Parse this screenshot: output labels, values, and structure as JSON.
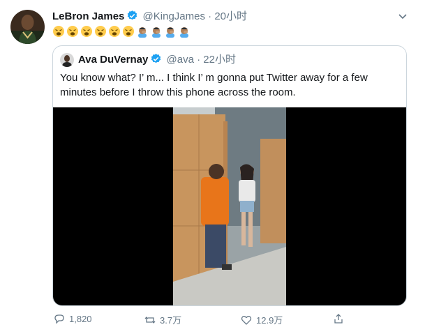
{
  "tweet": {
    "author_name": "LeBron James",
    "handle": "@KingJames",
    "separator": "·",
    "time": "20小时",
    "emojis": [
      "weary-face",
      "weary-face",
      "weary-face",
      "weary-face",
      "weary-face",
      "weary-face",
      "man-facepalming",
      "man-facepalming",
      "man-facepalming",
      "man-facepalming"
    ]
  },
  "quote": {
    "author_name": "Ava DuVernay",
    "handle": "@ava",
    "separator": "·",
    "time": "22小时",
    "text": "You know what? I’ m... I think I’ m gonna put Twitter away for a few minutes before I throw this phone across the room."
  },
  "actions": {
    "reply_count": "1,820",
    "retweet_count": "3.7万",
    "like_count": "12.9万"
  },
  "colors": {
    "verified": "#1da1f2",
    "muted": "#657786",
    "border": "#ccd6dd"
  }
}
